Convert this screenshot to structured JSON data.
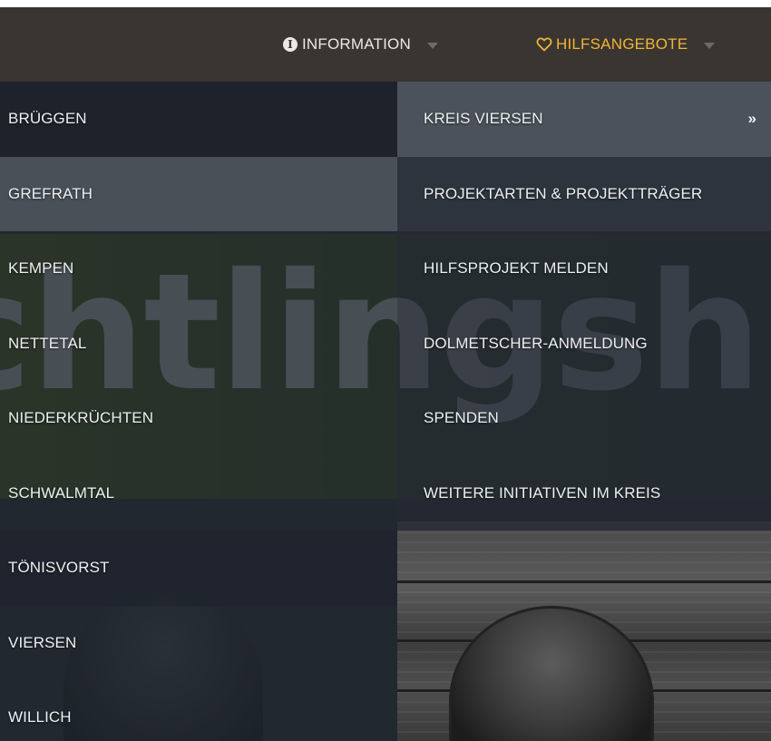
{
  "topnav": {
    "items": [
      {
        "label": "INFORMATION",
        "icon": "info-circle-icon"
      },
      {
        "label": "HILFSANGEBOTE",
        "icon": "heart-outline-icon"
      }
    ],
    "accent_color": "#f0b43a"
  },
  "background": {
    "banner_text": "chtlingshil"
  },
  "menu_left": {
    "items": [
      {
        "label": "BRÜGGEN"
      },
      {
        "label": "GREFRATH"
      },
      {
        "label": "KEMPEN"
      },
      {
        "label": "NETTETAL"
      },
      {
        "label": "NIEDERKRÜCHTEN"
      },
      {
        "label": "SCHWALMTAL"
      },
      {
        "label": "TÖNISVORST"
      },
      {
        "label": "VIERSEN"
      },
      {
        "label": "WILLICH"
      }
    ]
  },
  "menu_right": {
    "items": [
      {
        "label": "KREIS VIERSEN",
        "submenu_arrow": "»"
      },
      {
        "label": "PROJEKTARTEN & PROJEKTTRÄGER"
      },
      {
        "label": "HILFSPROJEKT MELDEN"
      },
      {
        "label": "DOLMETSCHER-ANMELDUNG"
      },
      {
        "label": "SPENDEN"
      },
      {
        "label": "WEITERE INITIATIVEN IM KREIS"
      }
    ]
  }
}
